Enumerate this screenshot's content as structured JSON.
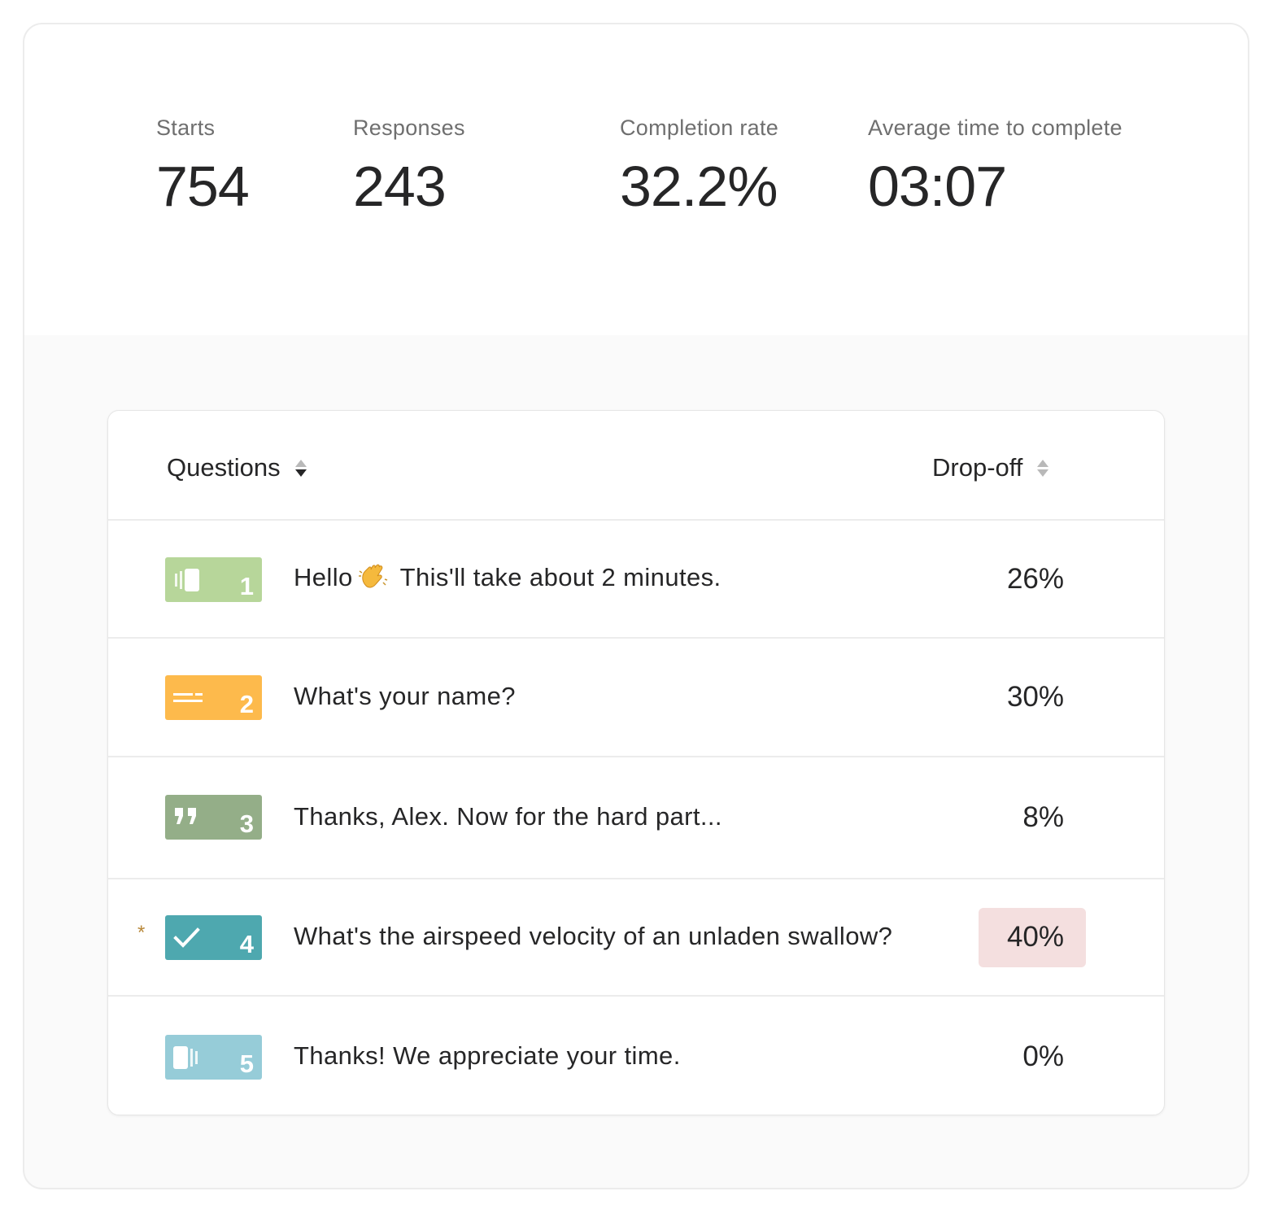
{
  "stats": {
    "starts": {
      "label": "Starts",
      "value": "754"
    },
    "responses": {
      "label": "Responses",
      "value": "243"
    },
    "completion": {
      "label": "Completion rate",
      "value": "32.2%"
    },
    "avg_time": {
      "label": "Average time to complete",
      "value": "03:07"
    }
  },
  "table": {
    "col_questions": "Questions",
    "col_dropoff": "Drop-off",
    "rows": [
      {
        "number": "1",
        "type_icon": "welcome-screen-icon",
        "color": "#b7d69a",
        "text_before": "Hello",
        "emoji_icon": "waving-hand-icon",
        "text_after": "This'll take about 2 minutes.",
        "dropoff": "26%",
        "highlight": false
      },
      {
        "number": "2",
        "type_icon": "short-text-icon",
        "color": "#fdba4c",
        "text": "What's your name?",
        "dropoff": "30%",
        "highlight": false
      },
      {
        "number": "3",
        "type_icon": "quote-icon",
        "color": "#94ae88",
        "text": "Thanks, Alex. Now for the hard part...",
        "dropoff": "8%",
        "highlight": false
      },
      {
        "number": "4",
        "type_icon": "checkmark-icon",
        "color": "#4ea8af",
        "required_mark": "*",
        "text": "What's the airspeed velocity of an unladen swallow?",
        "dropoff": "40%",
        "highlight": true,
        "highlight_color": "#f4dfdf"
      },
      {
        "number": "5",
        "type_icon": "thank-you-screen-icon",
        "color": "#96ccd8",
        "text": "Thanks! We appreciate your time.",
        "dropoff": "0%",
        "highlight": false
      }
    ]
  }
}
